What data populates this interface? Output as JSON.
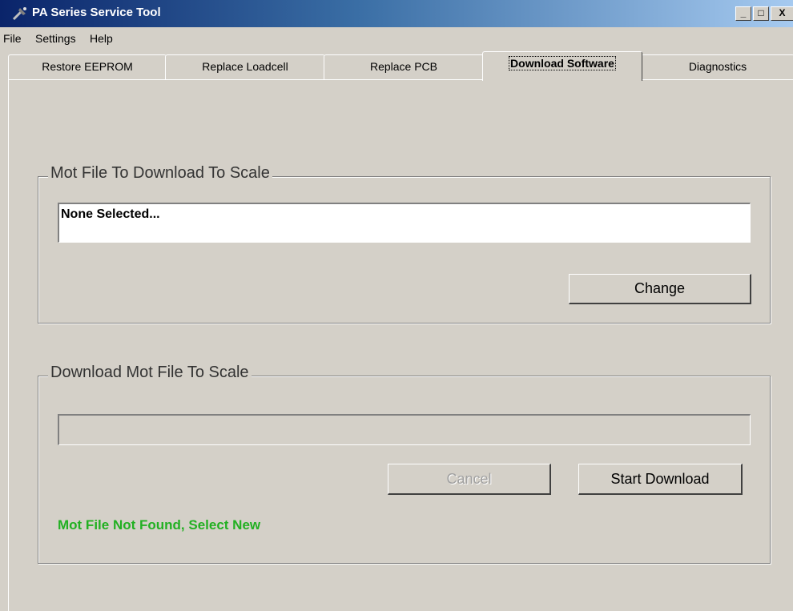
{
  "window": {
    "title": "PA Series Service Tool",
    "icon": "app-tool-icon",
    "controls": {
      "minimize": "_",
      "maximize": "□",
      "close": "X"
    }
  },
  "menu": {
    "items": [
      "File",
      "Settings",
      "Help"
    ]
  },
  "tabs": [
    {
      "label": "Restore EEPROM",
      "active": false
    },
    {
      "label": "Replace Loadcell",
      "active": false
    },
    {
      "label": "Replace PCB",
      "active": false
    },
    {
      "label": "Download Software",
      "active": true
    },
    {
      "label": "Diagnostics",
      "active": false
    }
  ],
  "mot_group": {
    "title": "Mot File To Download To Scale",
    "file_value": "None Selected...",
    "change_label": "Change"
  },
  "download_group": {
    "title": "Download Mot File To Scale",
    "progress_percent": 0,
    "cancel_label": "Cancel",
    "cancel_enabled": false,
    "start_label": "Start Download",
    "status_text": "Mot File Not Found, Select New",
    "status_color": "#22b022"
  }
}
